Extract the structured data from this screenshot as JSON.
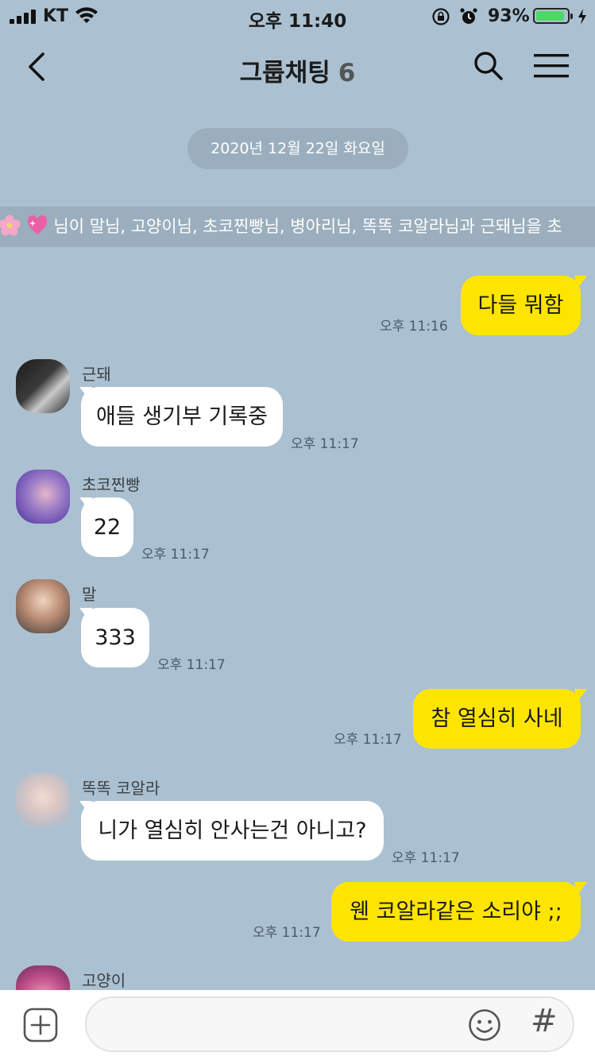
{
  "status_bar": {
    "carrier": "KT",
    "time": "오후 11:40",
    "battery_percent": "93%",
    "battery_level": 0.93
  },
  "header": {
    "title": "그룹채팅",
    "member_count": "6"
  },
  "date_divider": "2020년 12월 22일 화요일",
  "invite_notice": "님이 말님, 고양이님, 초코찐빵님, 병아리님, 똑똑 코알라님과 근돼님을 초",
  "messages": [
    {
      "sender": "",
      "text": "다들 뭐함",
      "time": "오후 11:16",
      "mine": true
    },
    {
      "sender": "근돼",
      "text": "애들 생기부 기록중",
      "time": "오후 11:17",
      "mine": false
    },
    {
      "sender": "초코찐빵",
      "text": "22",
      "time": "오후 11:17",
      "mine": false
    },
    {
      "sender": "말",
      "text": "333",
      "time": "오후 11:17",
      "mine": false
    },
    {
      "sender": "",
      "text": "참 열심히 사네",
      "time": "오후 11:17",
      "mine": true
    },
    {
      "sender": "똑똑 코알라",
      "text": "니가 열심히 안사는건 아니고?",
      "time": "오후 11:17",
      "mine": false
    },
    {
      "sender": "",
      "text": "웬 코알라같은 소리야 ;;",
      "time": "오후 11:17",
      "mine": true
    },
    {
      "sender": "고양이",
      "text": "",
      "time": "",
      "mine": false
    }
  ],
  "input": {
    "value": "",
    "placeholder": ""
  },
  "icons": {
    "back": "back-arrow-icon",
    "search": "search-icon",
    "menu": "hamburger-menu-icon",
    "plus": "plus-icon",
    "emoji": "emoji-icon",
    "hashtag": "hashtag-icon"
  },
  "colors": {
    "background": "#abc1d1",
    "my_bubble": "#fee500",
    "their_bubble": "#ffffff",
    "date_pill": "#9aaebd"
  }
}
